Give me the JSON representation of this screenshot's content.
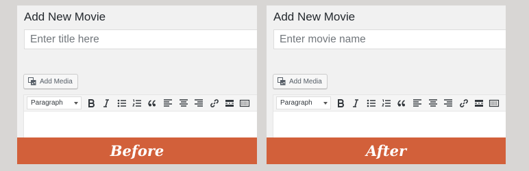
{
  "panels": {
    "before": {
      "heading": "Add New Movie",
      "title_placeholder": "Enter title here",
      "add_media_label": "Add Media",
      "format_value": "Paragraph",
      "banner": "Before"
    },
    "after": {
      "heading": "Add New Movie",
      "title_placeholder": "Enter movie name",
      "add_media_label": "Add Media",
      "format_value": "Paragraph",
      "banner": "After"
    }
  },
  "toolbar_icons": [
    "bold-icon",
    "italic-icon",
    "bulleted-list-icon",
    "numbered-list-icon",
    "blockquote-icon",
    "align-left-icon",
    "align-center-icon",
    "align-right-icon",
    "link-icon",
    "read-more-icon",
    "toolbar-toggle-icon"
  ],
  "colors": {
    "banner": "#d2603a",
    "page_background": "#d8d6d4",
    "panel_background": "#f1f1f1"
  }
}
